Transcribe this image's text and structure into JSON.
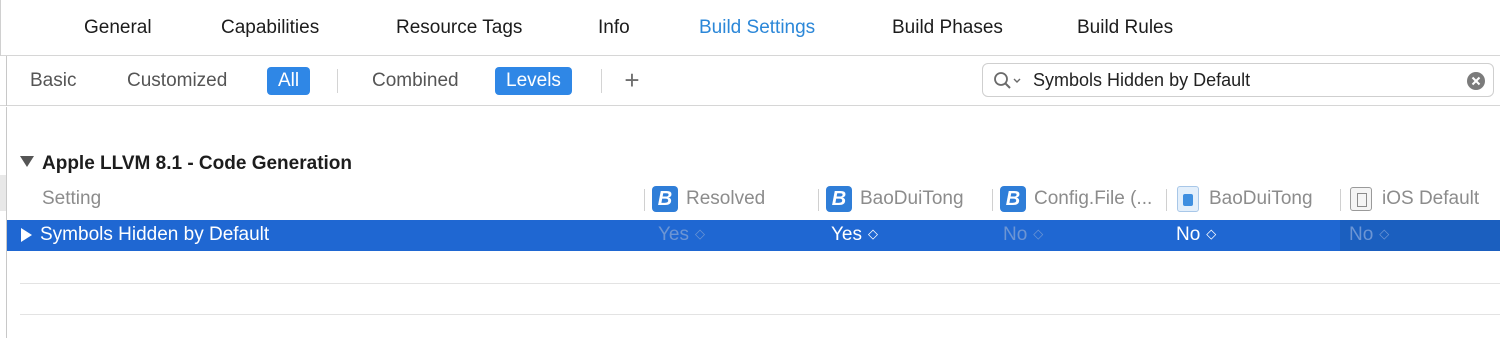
{
  "tabs": [
    {
      "label": "General",
      "active": false
    },
    {
      "label": "Capabilities",
      "active": false
    },
    {
      "label": "Resource Tags",
      "active": false
    },
    {
      "label": "Info",
      "active": false
    },
    {
      "label": "Build Settings",
      "active": true
    },
    {
      "label": "Build Phases",
      "active": false
    },
    {
      "label": "Build Rules",
      "active": false
    }
  ],
  "filters": {
    "basic": "Basic",
    "customized": "Customized",
    "all": "All",
    "combined": "Combined",
    "levels": "Levels",
    "add_symbol": "+"
  },
  "search": {
    "value": "Symbols Hidden by Default",
    "icon": "magnifying-glass-icon",
    "clear_icon": "clear-icon"
  },
  "section": {
    "title": "Apple LLVM 8.1 - Code Generation",
    "columns": {
      "setting": "Setting",
      "resolved": "Resolved",
      "target": "BaoDuiTong",
      "config_file": "Config.File (...",
      "project": "BaoDuiTong",
      "ios_default": "iOS Default"
    },
    "column_icons": {
      "resolved": "B",
      "target": "B",
      "config_file": "B"
    },
    "row": {
      "name": "Symbols Hidden by Default",
      "resolved": "Yes",
      "target": "Yes",
      "config_file": "No",
      "project": "No",
      "ios_default": "No",
      "stepper_glyph": "◇"
    }
  },
  "colors": {
    "accent": "#2b87d8",
    "selected_row": "#1f67d2",
    "toggle_on": "#2f87e6"
  }
}
